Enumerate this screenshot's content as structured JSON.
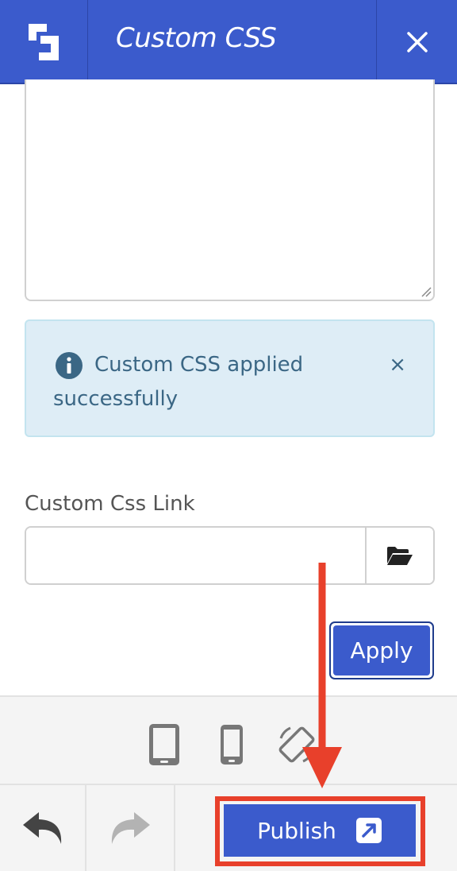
{
  "header": {
    "title": "Custom CSS",
    "logo_icon": "builder-logo-icon",
    "close_icon": "close-icon"
  },
  "editor": {
    "value": ""
  },
  "alert": {
    "message": "Custom CSS applied successfully",
    "icon": "info-circle-icon",
    "dismiss": "×"
  },
  "css_link": {
    "label": "Custom Css Link",
    "value": "",
    "browse_icon": "folder-open-icon"
  },
  "apply_button": {
    "label": "Apply"
  },
  "devices": {
    "items": [
      "tablet-icon",
      "mobile-icon",
      "rotate-icon"
    ]
  },
  "footer": {
    "undo_icon": "undo-icon",
    "redo_icon": "redo-icon",
    "publish_label": "Publish",
    "publish_icon": "external-link-icon"
  },
  "colors": {
    "primary": "#3b5bcc",
    "alert_bg": "#deedf6",
    "alert_text": "#3b6785",
    "highlight": "#e8402b"
  }
}
